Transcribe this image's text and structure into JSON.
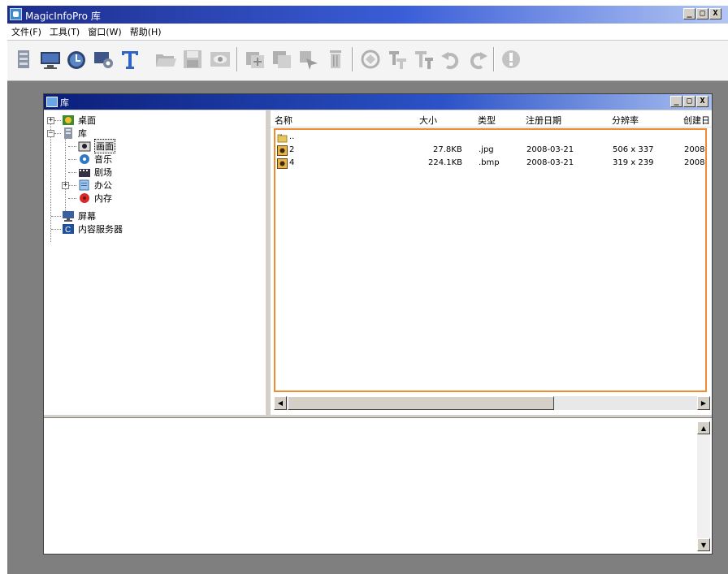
{
  "app": {
    "title": "MagicInfoPro 库",
    "window_buttons": [
      "_",
      "□",
      "X"
    ]
  },
  "menu": {
    "items": [
      "文件(F)",
      "工具(T)",
      "窗口(W)",
      "帮助(H)"
    ]
  },
  "toolbar": {
    "icons": [
      "library-icon",
      "screen-icon",
      "schedule-icon",
      "settings-icon",
      "text-icon",
      "open-folder-icon",
      "save-icon",
      "preview-icon",
      "new-page-icon",
      "copy-page-icon",
      "transfer-icon",
      "delete-icon",
      "sync-icon",
      "text-align-icon",
      "text-format-icon",
      "undo-icon",
      "redo-icon",
      "info-icon"
    ]
  },
  "library_window": {
    "title": "库",
    "tree": {
      "desktop": "桌面",
      "library": "库",
      "image": "画面",
      "music": "音乐",
      "theater": "剧场",
      "office": "办公",
      "memory": "内存",
      "screen": "屏幕",
      "content_server": "内容服务器"
    },
    "list": {
      "headers": {
        "name": "名称",
        "size": "大小",
        "type": "类型",
        "date": "注册日期",
        "resolution": "分辨率",
        "created": "创建日"
      },
      "parent_row": "..",
      "rows": [
        {
          "name": "2",
          "size": "27.8KB",
          "type": ".jpg",
          "date": "2008-03-21",
          "resolution": "506 x 337",
          "created": "2008"
        },
        {
          "name": "4",
          "size": "224.1KB",
          "type": ".bmp",
          "date": "2008-03-21",
          "resolution": "319 x 239",
          "created": "2008"
        }
      ]
    }
  },
  "colors": {
    "title_bar_start": "#1c2c8c",
    "title_bar_end": "#b3c6f3",
    "highlight_border": "#f28a2f",
    "workspace": "#7f7f7f"
  }
}
